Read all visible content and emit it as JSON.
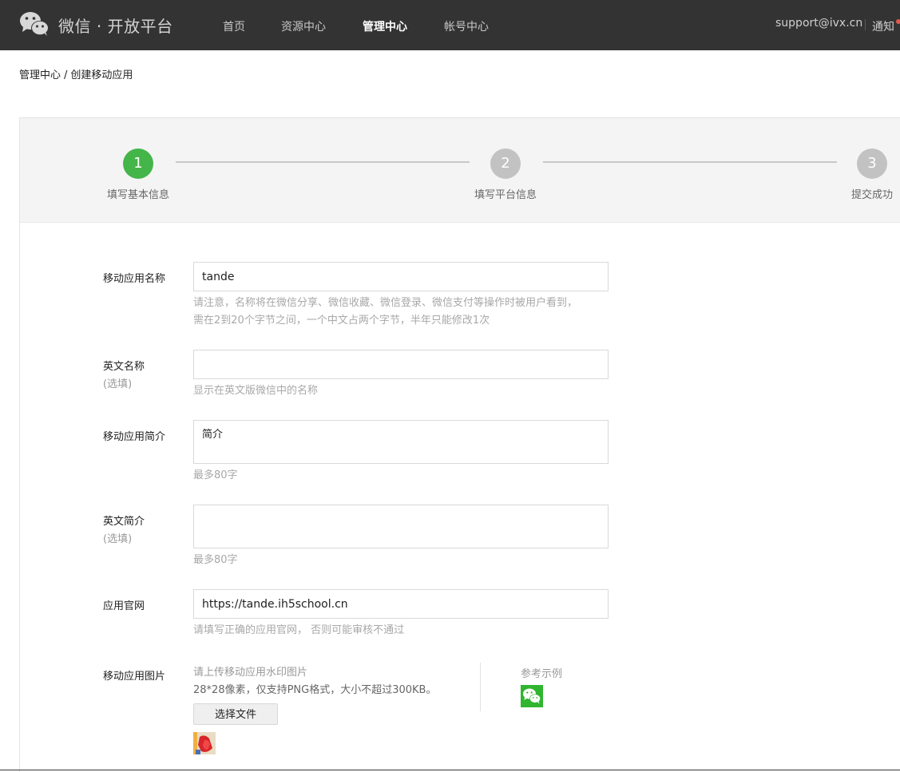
{
  "header": {
    "brand": "微信 · 开放平台",
    "nav": [
      {
        "label": "首页",
        "active": false
      },
      {
        "label": "资源中心",
        "active": false
      },
      {
        "label": "管理中心",
        "active": true
      },
      {
        "label": "帐号中心",
        "active": false
      }
    ],
    "account": "support@ivx.cn",
    "notify": "通知",
    "bg_color": "#333333"
  },
  "breadcrumb": {
    "parent": "管理中心",
    "separator": "/",
    "current": "创建移动应用"
  },
  "steps": [
    {
      "number": "1",
      "label": "填写基本信息",
      "status": "done"
    },
    {
      "number": "2",
      "label": "填写平台信息",
      "status": "todo"
    },
    {
      "number": "3",
      "label": "提交成功",
      "status": "todo"
    }
  ],
  "form": {
    "app_name": {
      "label": "移动应用名称",
      "value": "tande",
      "hint1": "请注意，名称将在微信分享、微信收藏、微信登录、微信支付等操作时被用户看到，",
      "hint2": "需在2到20个字节之间，一个中文占两个字节，半年只能修改1次"
    },
    "english_name": {
      "label": "英文名称",
      "optional": "(选填)",
      "value": "",
      "hint": "显示在英文版微信中的名称"
    },
    "intro": {
      "label": "移动应用简介",
      "value": "简介",
      "hint": "最多80字"
    },
    "english_intro": {
      "label": "英文简介",
      "optional": "(选填)",
      "value": "",
      "hint": "最多80字"
    },
    "website": {
      "label": "应用官网",
      "value": "https://tande.ih5school.cn",
      "hint": "请填写正确的应用官网， 否则可能审核不通过"
    },
    "image": {
      "label": "移动应用图片",
      "tip1": "请上传移动应用水印图片",
      "tip2": "28*28像素，仅支持PNG格式，大小不超过300KB。",
      "button": "选择文件",
      "example_label": "参考示例"
    }
  },
  "colors": {
    "accent_green": "#44b549",
    "step_inactive": "#c2c2c2",
    "hint_gray": "#a8a8a8"
  }
}
